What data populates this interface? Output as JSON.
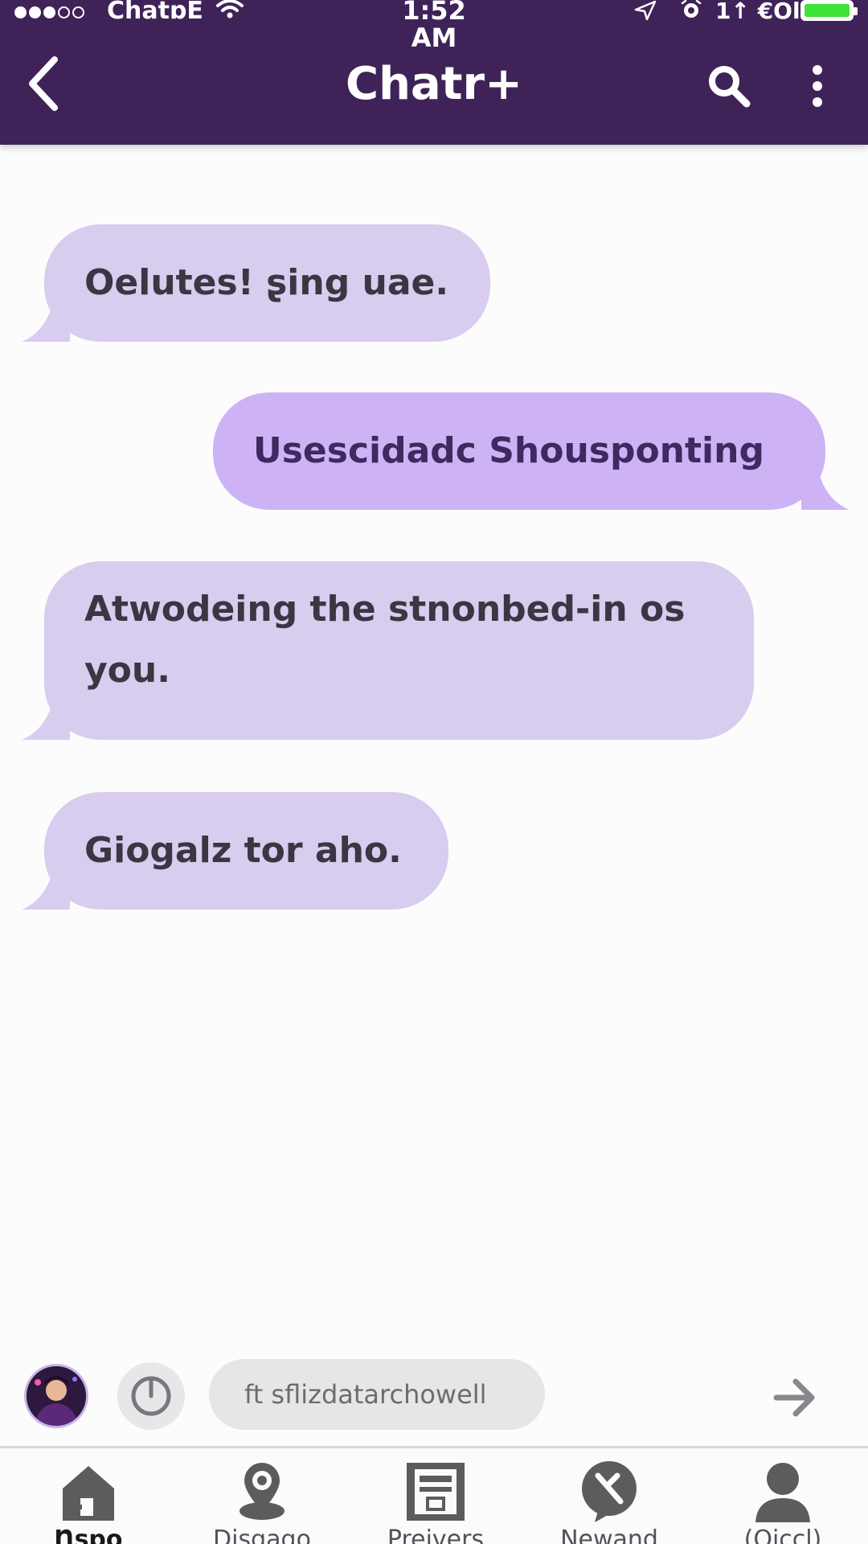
{
  "status_bar": {
    "carrier": "ChatɒE",
    "time": "1:52 AM",
    "extra": "1↑ €Ol",
    "battery_color": "#3ee23a"
  },
  "app_bar": {
    "title": "Chatr+",
    "background_color": "#3f2358",
    "back_icon": "chevron-left-icon",
    "search_icon": "search-icon",
    "more_icon": "more-vertical-icon"
  },
  "messages": [
    {
      "direction": "incoming",
      "text": "Oelutes! ʂing uae."
    },
    {
      "direction": "outgoing",
      "text": "Usescidadc Shousponting"
    },
    {
      "direction": "incoming",
      "text": "Atwodeing the stnonbed-in os you."
    },
    {
      "direction": "incoming",
      "text": "Giogalz tor aho."
    }
  ],
  "colors": {
    "incoming_bubble": "#d8ccef",
    "outgoing_bubble": "#cdb3f6"
  },
  "composer": {
    "placeholder": "ft sflizdatarchowell",
    "timer_icon": "timer-icon",
    "send_icon": "arrow-right-icon"
  },
  "bottom_nav": [
    {
      "label": "Ƞspo",
      "icon": "home-icon",
      "active": true
    },
    {
      "label": "Disgago",
      "icon": "location-pin-icon",
      "active": false
    },
    {
      "label": "Preivers",
      "icon": "archive-icon",
      "active": false
    },
    {
      "label": "Newand",
      "icon": "chat-tools-icon",
      "active": false
    },
    {
      "label": "(Oiccl)",
      "icon": "profile-icon",
      "active": false
    }
  ]
}
